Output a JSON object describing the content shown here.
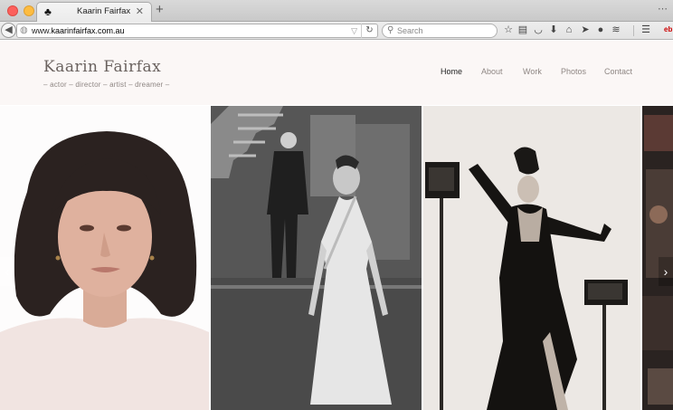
{
  "browser": {
    "tab_title": "Kaarin Fairfax",
    "url_prefix": "www.",
    "url_domain": "kaarinfairfax.com.au",
    "search_placeholder": "Search"
  },
  "site": {
    "title": "Kaarin Fairfax",
    "tagline": "– actor – director – artist – dreamer –"
  },
  "nav": {
    "home": "Home",
    "about": "About",
    "work": "Work",
    "photos": "Photos",
    "contact": "Contact"
  },
  "colors": {
    "header_bg": "#fbf7f6",
    "logo": "#6a625f",
    "nav_active": "#222222",
    "nav_inactive": "#8f8784"
  },
  "icons": {
    "favicon": "club-icon",
    "slider_prev": "chevron-left-icon",
    "slider_next": "chevron-right-icon"
  }
}
